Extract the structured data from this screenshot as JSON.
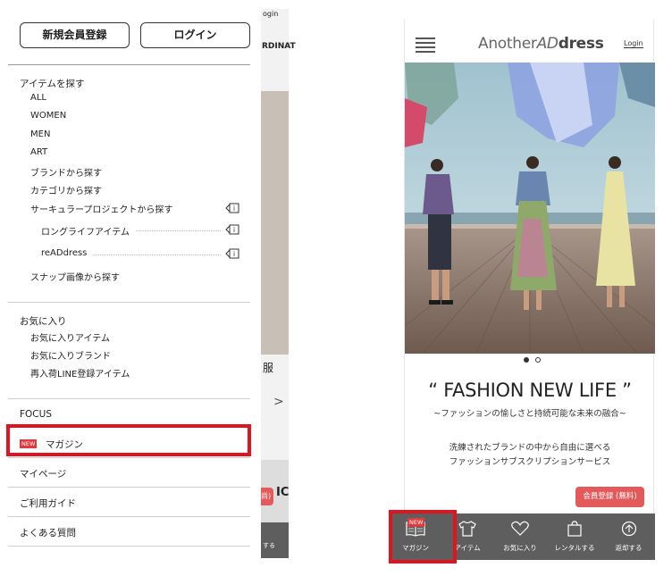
{
  "drawer": {
    "register_button": "新規会員登録",
    "login_button": "ログイン",
    "section_items": "アイテムを探す",
    "item_links": [
      "ALL",
      "WOMEN",
      "MEN",
      "ART",
      "ブランドから探す",
      "カテゴリから探す",
      "サーキュラープロジェクトから探す"
    ],
    "longlife": "ロングライフアイテム",
    "readdress": "reADdress",
    "snap": "スナップ画像から探す",
    "section_fav": "お気に入り",
    "fav_links": [
      "お気に入りアイテム",
      "お気に入りブランド",
      "再入荷LINE登録アイテム"
    ],
    "focus": "FOCUS",
    "new_badge": "NEW",
    "magazine": "マガジン",
    "mypage": "マイページ",
    "guide": "ご利用ガイド",
    "faq": "よくある質問"
  },
  "behind": {
    "login_peek": "ogin",
    "ordinate_peek": "RDINAT",
    "kanji_peek": "服",
    "badge_peek": "尚)",
    "ic_peek": "IC",
    "small_peek": "する"
  },
  "phone": {
    "brand_prefix": "Another",
    "brand_ad": "AD",
    "brand_suffix": "dress",
    "login": "Login",
    "headline": "“ FASHION NEW LIFE ”",
    "subhead": "~ファッションの愉しさと持続可能な未来の融合~",
    "desc_line1": "洗練されたブランドの中から自由に選べる",
    "desc_line2": "ファッションサブスクリプションサービス",
    "signup": "会員登録 (無料)",
    "tabs": [
      {
        "label": "マガジン",
        "icon": "book-icon"
      },
      {
        "label": "アイテム",
        "icon": "shirt-icon"
      },
      {
        "label": "お気に入り",
        "icon": "heart-icon"
      },
      {
        "label": "レンタルする",
        "icon": "bag-icon"
      },
      {
        "label": "返却する",
        "icon": "return-icon"
      }
    ],
    "tab_new_badge": "NEW"
  },
  "colors": {
    "highlight": "#e0141e",
    "signup_bg": "#e45a5a",
    "tabbar_bg": "#5e5e5e"
  }
}
